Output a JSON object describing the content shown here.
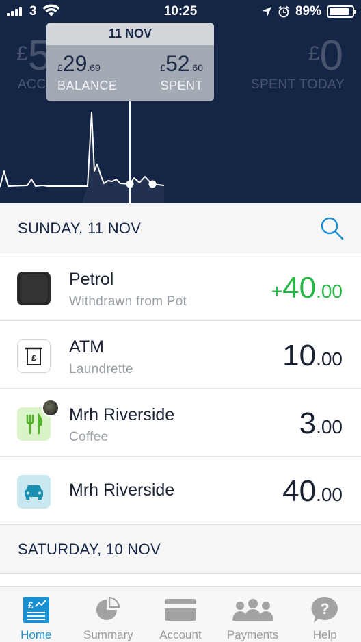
{
  "status_bar": {
    "carrier": "3",
    "time": "10:25",
    "battery": "89%",
    "battery_level": 0.89
  },
  "header": {
    "balance_partial": "5",
    "balance_currency": "£",
    "balance_label_partial": "ACC",
    "spent_today_value": "0",
    "spent_today_currency": "£",
    "spent_today_label": "SPENT TODAY"
  },
  "tooltip": {
    "date": "11 NOV",
    "balance_currency": "£",
    "balance_whole": "29",
    "balance_pence": ".69",
    "balance_label": "BALANCE",
    "spent_currency": "£",
    "spent_whole": "52",
    "spent_pence": ".60",
    "spent_label": "SPENT"
  },
  "sections": [
    {
      "title": "SUNDAY, 11 NOV",
      "transactions": [
        {
          "name": "Petrol",
          "subtitle": "Withdrawn from Pot",
          "sign": "+",
          "whole": "40",
          "pence": ".00",
          "type": "credit",
          "icon": "pot-icon"
        },
        {
          "name": "ATM",
          "subtitle": "Laundrette",
          "sign": "",
          "whole": "10",
          "pence": ".00",
          "type": "debit",
          "icon": "atm-icon"
        },
        {
          "name": "Mrh Riverside",
          "subtitle": "Coffee",
          "sign": "",
          "whole": "3",
          "pence": ".00",
          "type": "debit",
          "icon": "eating-out-icon"
        },
        {
          "name": "Mrh Riverside",
          "subtitle": "",
          "sign": "",
          "whole": "40",
          "pence": ".00",
          "type": "debit",
          "icon": "transport-car-icon"
        }
      ]
    },
    {
      "title": "SATURDAY, 10 NOV",
      "transactions": []
    }
  ],
  "tabs": [
    {
      "label": "Home",
      "icon": "home-icon",
      "active": true
    },
    {
      "label": "Summary",
      "icon": "pie-chart-icon",
      "active": false
    },
    {
      "label": "Account",
      "icon": "card-icon",
      "active": false
    },
    {
      "label": "Payments",
      "icon": "people-icon",
      "active": false
    },
    {
      "label": "Help",
      "icon": "help-icon",
      "active": false
    }
  ],
  "colors": {
    "header_bg": "#152546",
    "accent": "#1a8fd1",
    "credit": "#27b847"
  }
}
